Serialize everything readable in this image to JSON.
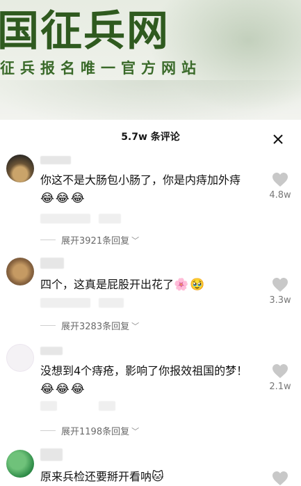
{
  "banner": {
    "title": "国征兵网",
    "subtitle": "征兵报名唯一官方网站"
  },
  "sheet": {
    "title": "5.7w 条评论",
    "close_icon": "close-icon"
  },
  "comments": [
    {
      "text": "你这不是大肠包小肠了，你是内痔加外痔",
      "emojis": [
        "😂",
        "😂",
        "😂"
      ],
      "likes": "4.8w",
      "replies": "展开3921条回复"
    },
    {
      "text": "四个，这真是屁股开出花了",
      "emojis": [
        "🌸",
        "🥹"
      ],
      "likes": "3.3w",
      "replies": "展开3283条回复"
    },
    {
      "text": "没想到4个痔疮，影响了你报效祖国的梦！",
      "emojis": [
        "😂",
        "😂",
        "😂"
      ],
      "likes": "2.1w",
      "replies": "展开1198条回复"
    },
    {
      "text": "原来兵检还要掰开看呐",
      "emojis": [
        "🐱"
      ],
      "likes": "",
      "replies": ""
    }
  ],
  "icons": {
    "heart": "heart-icon",
    "chevron": "chevron-down-icon"
  }
}
